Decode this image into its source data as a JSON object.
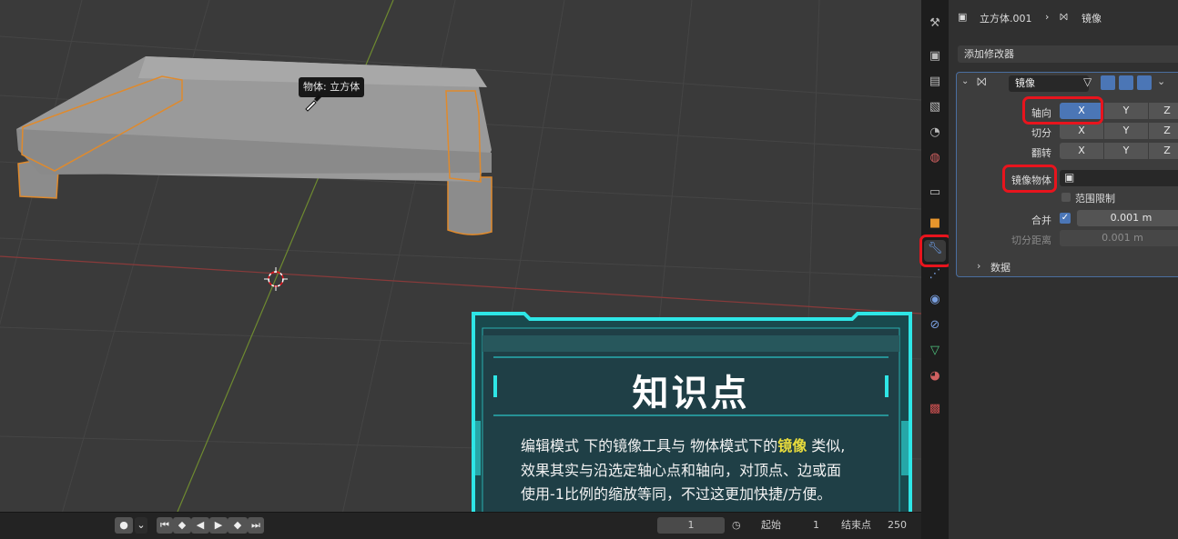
{
  "viewport": {
    "tooltip": "物体: 立方体"
  },
  "timeline": {
    "current_frame": "1",
    "start_label": "起始",
    "start_value": "1",
    "end_label": "结束点",
    "end_value": "250"
  },
  "properties": {
    "breadcrumb": {
      "object": "立方体.001",
      "modifier": "镜像"
    },
    "add_modifier": "添加修改器",
    "modifier": {
      "name": "镜像",
      "axis_label": "轴向",
      "bisect_label": "切分",
      "flip_label": "翻转",
      "axes": [
        "X",
        "Y",
        "Z"
      ],
      "mirror_object_label": "镜像物体",
      "clipping_label": "范围限制",
      "merge_label": "合并",
      "merge_value": "0.001 m",
      "bisect_distance_label": "切分距离",
      "bisect_distance_value": "0.001 m",
      "data_label": "数据"
    }
  },
  "knowledge_card": {
    "title": "知识点",
    "line1_a": "编辑模式 下的镜像工具与 物体模式下的",
    "line1_highlight": "镜像",
    "line1_b": " 类似,",
    "line2": "效果其实与沿选定轴心点和轴向，对顶点、边或面",
    "line3": "使用-1比例的缩放等同，不过这更加快捷/方便。"
  },
  "colors": {
    "viewport_bg": "#3a3a3a",
    "selection_orange": "#e08a2c",
    "active_axis_blue": "#4b76b6",
    "highlight_red": "#e8141d",
    "card_teal": "#2ee6e6",
    "card_highlight_yellow": "#e8dc3c"
  },
  "icons": [
    "tool-icon",
    "render-icon",
    "output-icon",
    "view-layer-icon",
    "scene-icon",
    "world-icon",
    "collection-icon",
    "object-icon",
    "modifier-wrench-icon",
    "particles-icon",
    "physics-icon",
    "constraints-icon",
    "object-data-icon",
    "material-icon",
    "texture-icon"
  ]
}
